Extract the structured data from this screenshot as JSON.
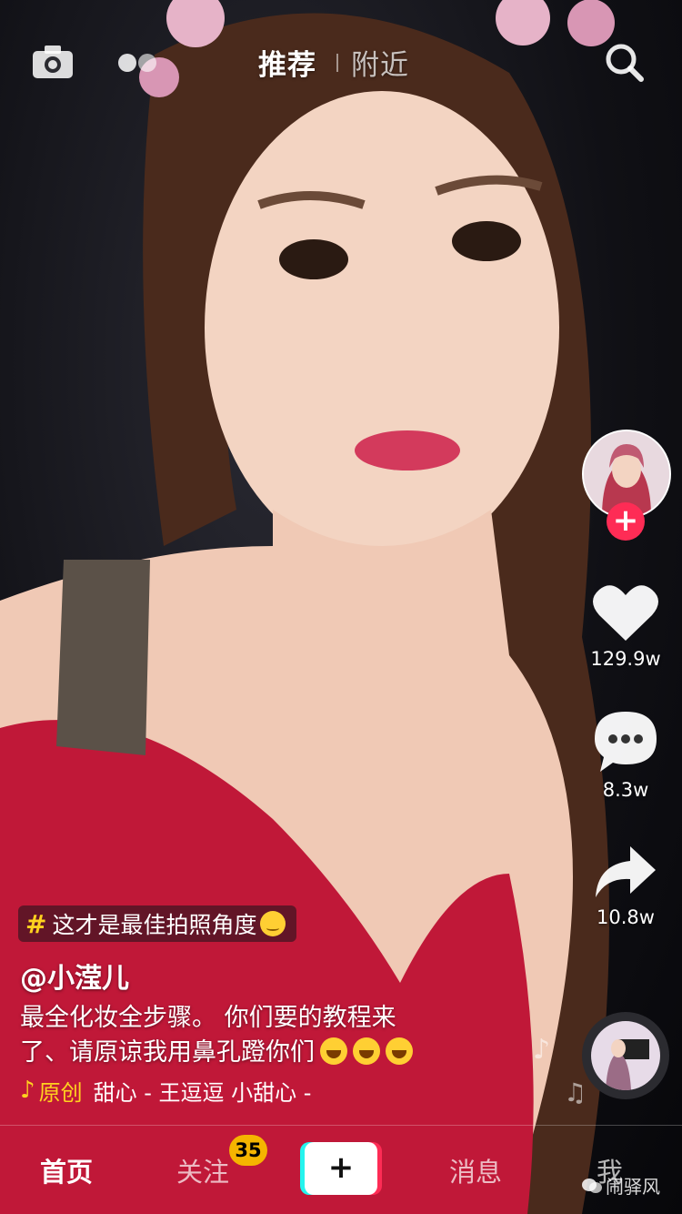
{
  "top": {
    "tabs": [
      {
        "label": "推荐",
        "active": true
      },
      {
        "label": "附近",
        "active": false
      }
    ],
    "icons": [
      "camera-icon",
      "live-icon",
      "search-icon"
    ]
  },
  "actions": {
    "follow_label": "+",
    "likes": "129.9w",
    "comments": "8.3w",
    "shares": "10.8w"
  },
  "post": {
    "hashtag": "这才是最佳拍照角度",
    "username": "@小滢儿",
    "description_line1": "最全化妆全步骤。   你们要的教程来",
    "description_line2": "了、请原谅我用鼻孔蹬你们",
    "music_origin": "原创",
    "music_track": "甜心 - 王逗逗    小甜心 -"
  },
  "nav": {
    "home": "首页",
    "follow": "关注",
    "follow_badge": "35",
    "add": "+",
    "messages": "消息",
    "me": "我"
  },
  "watermark": "闹驿风",
  "colors": {
    "accent_red": "#fe2c55",
    "accent_cyan": "#25f4ee",
    "hashtag_yellow": "#ffd21f",
    "badge": "#f5b400"
  }
}
